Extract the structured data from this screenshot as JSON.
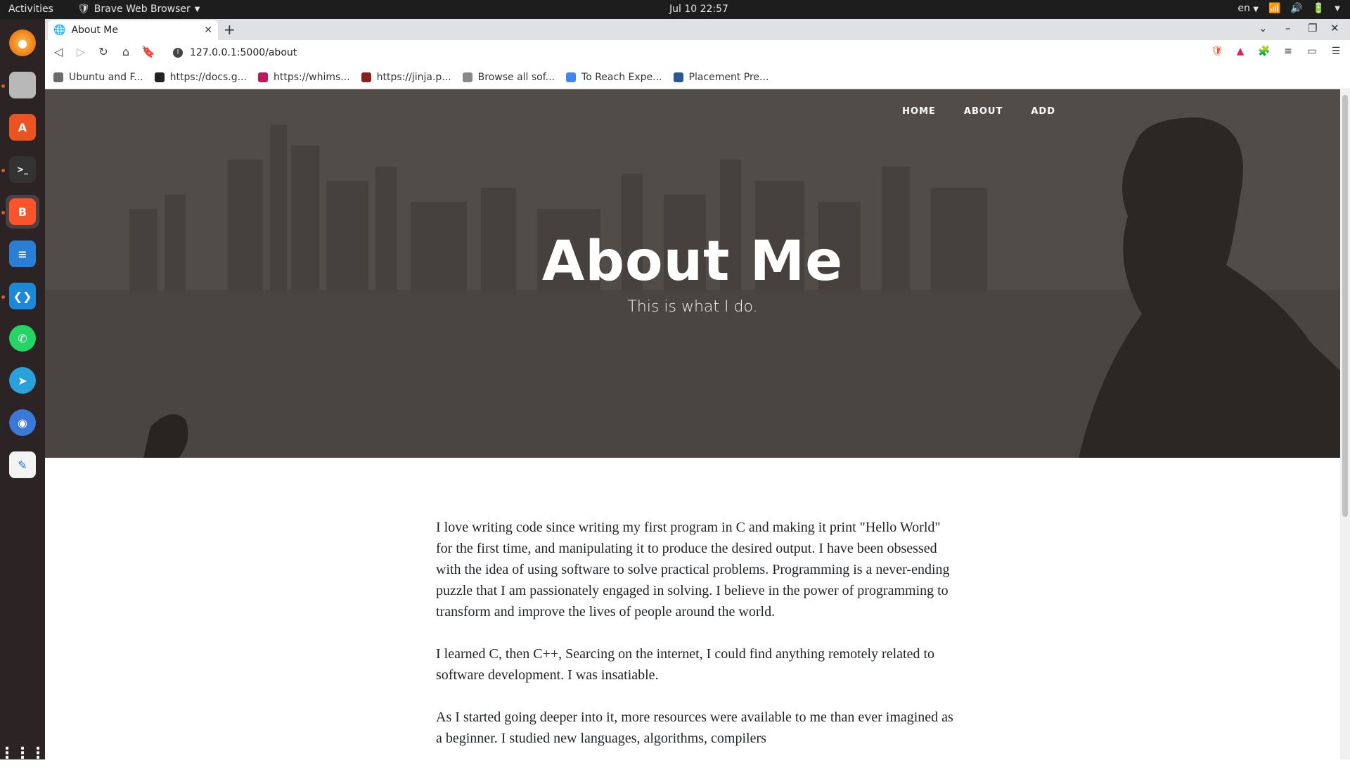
{
  "topbar": {
    "activities": "Activities",
    "app_name": "Brave Web Browser",
    "clock": "Jul 10  22:57",
    "lang": "en"
  },
  "dock": {
    "apps": [
      "firefox",
      "files",
      "software-center",
      "terminal",
      "brave",
      "text-document",
      "vscode",
      "whatsapp",
      "telegram",
      "chromium",
      "text-editor",
      "app-grid"
    ]
  },
  "browser": {
    "tab_title": "About Me",
    "url": "127.0.0.1:5000/about",
    "bookmarks": [
      {
        "label": "Ubuntu and F...",
        "icon": "folder-icon",
        "color": "#6b6b6b"
      },
      {
        "label": "https://docs.g...",
        "icon": "github-icon",
        "color": "#222222"
      },
      {
        "label": "https://whims...",
        "icon": "m-icon",
        "color": "#c2185b"
      },
      {
        "label": "https://jinja.p...",
        "icon": "jinja-icon",
        "color": "#8a1f1f"
      },
      {
        "label": "Browse all sof...",
        "icon": "dash-icon",
        "color": "#888888"
      },
      {
        "label": "To Reach Expe...",
        "icon": "docs-icon",
        "color": "#4285f4"
      },
      {
        "label": "Placement Pre...",
        "icon": "word-icon",
        "color": "#2b579a"
      }
    ]
  },
  "site": {
    "nav": [
      "HOME",
      "ABOUT",
      "ADD"
    ],
    "title": "About Me",
    "subtitle": "This is what I do.",
    "paragraphs": [
      "I love writing code since writing my first program in C and making it print \"Hello World\" for the first time, and manipulating it to produce the desired output. I have been obsessed with the idea of using software to solve practical problems. Programming is a never-ending puzzle that I am passionately engaged in solving. I believe in the power of programming to transform and improve the lives of people around the world.",
      "I learned C, then C++, Searcing on the internet, I could find anything remotely related to software development. I was insatiable.",
      "As I started going deeper into it, more resources were available to me than ever imagined as a beginner. I studied new languages, algorithms, compilers"
    ]
  }
}
